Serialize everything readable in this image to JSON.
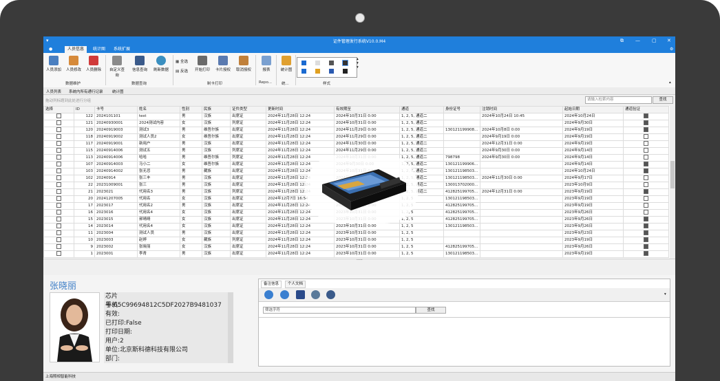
{
  "app": {
    "title": "证件管理发行系统V10.0.M4"
  },
  "menu": {
    "tabs": [
      "人员信息",
      "统计图",
      "系统扩展"
    ]
  },
  "ribbon": {
    "data_edit": {
      "label": "数据维护",
      "buttons": [
        "人员添加",
        "人员修改",
        "人员删除"
      ]
    },
    "data_query": {
      "label": "数据查询",
      "buttons": [
        "自定义查询",
        "信息查询",
        "刷新数据"
      ]
    },
    "card_print": {
      "label": "制卡打印",
      "select_all": "全选",
      "invert": "反选",
      "buttons": [
        "开始打印",
        "卡片授权",
        "取消授权"
      ]
    },
    "report": {
      "label": "Repo...",
      "button": "报表"
    },
    "stats": {
      "label": "统...",
      "button": "统计图"
    },
    "style": {
      "label": "样式"
    }
  },
  "subtabs": [
    "人员列表",
    "系统内所有通行记录",
    "统计图"
  ],
  "group_hint": "拖动列标题到此处进行分组",
  "search": {
    "placeholder": "请输入检索内容",
    "button": "查找"
  },
  "table": {
    "columns": [
      "选择",
      "ID",
      "卡号",
      "姓名",
      "性别",
      "民族",
      "证件类型",
      "更新时间",
      "有效期至",
      "通道",
      "身份证号",
      "注销时间",
      "起始日期",
      "通道验证"
    ],
    "rows": [
      {
        "id": "122",
        "card": "2024101101",
        "name": "test",
        "sex": "男",
        "nation": "汉族",
        "type": "出席证",
        "update": "2024年11月28日 12:24",
        "valid": "2024年10月31日 0:00",
        "channel": "1, 2, 5, 通道二",
        "idno": "",
        "cancel": "2024年10月24日 10:45",
        "start": "2024年10月24日",
        "verify": true
      },
      {
        "id": "121",
        "card": "20240930001",
        "name": "2024测试内容",
        "sex": "女",
        "nation": "汉族",
        "type": "列席证",
        "update": "2024年11月28日 12:24",
        "valid": "2024年10月31日 0:00",
        "channel": "1, 2, 5, 通道二",
        "idno": "",
        "cancel": "",
        "start": "2024年9月30日",
        "verify": true
      },
      {
        "id": "120",
        "card": "20240919003",
        "name": "测试3",
        "sex": "男",
        "nation": "维吾尔族",
        "type": "出席证",
        "update": "2024年11月28日 12:24",
        "valid": "2024年11月29日 0:00",
        "channel": "1, 2, 5, 通道二",
        "idno": "130121199908...",
        "cancel": "2024年10月8日 0:00",
        "start": "2024年9月19日",
        "verify": true
      },
      {
        "id": "118",
        "card": "20240919002",
        "name": "测试人员2",
        "sex": "女",
        "nation": "维吾尔族",
        "type": "出席证",
        "update": "2024年11月28日 12:24",
        "valid": "2024年11月29日 0:00",
        "channel": "1, 2, 5, 通道二",
        "idno": "",
        "cancel": "2024年9月19日 0:00",
        "start": "2024年9月19日",
        "verify": false
      },
      {
        "id": "117",
        "card": "20240919001",
        "name": "新用户",
        "sex": "男",
        "nation": "汉族",
        "type": "出席证",
        "update": "2024年11月28日 12:24",
        "valid": "2024年11月30日 0:00",
        "channel": "1, 2, 5, 通道二",
        "idno": "",
        "cancel": "2024年12月31日 0:00",
        "start": "2024年9月19日",
        "verify": false
      },
      {
        "id": "115",
        "card": "20240914006",
        "name": "测试五",
        "sex": "男",
        "nation": "汉族",
        "type": "列席证",
        "update": "2024年11月28日 12:24",
        "valid": "2024年11月29日 0:00",
        "channel": "1, 2, 5, 通道二",
        "idno": "",
        "cancel": "2024年9月30日 0:00",
        "start": "2024年9月14日",
        "verify": false
      },
      {
        "id": "113",
        "card": "20240914006",
        "name": "哈哈",
        "sex": "男",
        "nation": "维吾尔族",
        "type": "列席证",
        "update": "2024年11月28日 12:24",
        "valid": "2024年10月31日 0:00",
        "channel": "1, 2, 5, 通道二",
        "idno": "798798",
        "cancel": "2024年9月30日 0:00",
        "start": "2024年9月14日",
        "verify": false
      },
      {
        "id": "107",
        "card": "20240914003",
        "name": "马小二",
        "sex": "女",
        "nation": "维吾尔族",
        "type": "出席证",
        "update": "2024年11月28日 12:24",
        "valid": "2024年9月30日 0:00",
        "channel": "1, 2, 5, 通道二",
        "idno": "130121199906...",
        "cancel": "",
        "start": "2024年9月14日",
        "verify": true
      },
      {
        "id": "103",
        "card": "20240914002",
        "name": "张无忌",
        "sex": "男",
        "nation": "藏族",
        "type": "出席证",
        "update": "2024年11月28日 12:24",
        "valid": "2024年10月31日 0:00",
        "channel": "1, 2, 5, 通道二",
        "idno": "130121198503...",
        "cancel": "",
        "start": "2024年10月24日",
        "verify": true
      },
      {
        "id": "102",
        "card": "20240914",
        "name": "张三丰",
        "sex": "男",
        "nation": "汉族",
        "type": "出席证",
        "update": "2024年11月28日 12:24",
        "valid": "2024年10月31日 0:00",
        "channel": "1, 2, 5, 通道二",
        "idno": "130121198503...",
        "cancel": "2024年11月30日 0:00",
        "start": "2024年9月17日",
        "verify": false
      },
      {
        "id": "22",
        "card": "20231009001",
        "name": "张三",
        "sex": "男",
        "nation": "汉族",
        "type": "出席证",
        "update": "2024年11月28日 12:24",
        "valid": "2023年10月31日 0:00",
        "channel": "1, 2, 5, 通道二",
        "idno": "130013702000...",
        "cancel": "",
        "start": "2023年10月9日",
        "verify": false
      },
      {
        "id": "21",
        "card": "2023021",
        "name": "代用名3",
        "sex": "男",
        "nation": "汉族",
        "type": "列席证",
        "update": "2024年11月28日 12:24",
        "valid": "2023年10月31日 0:00",
        "channel": "1, 2, 5, 通道二",
        "idno": "412825199705...",
        "cancel": "2024年12月31日 0:00",
        "start": "2023年9月19日",
        "verify": true
      },
      {
        "id": "20",
        "card": "20241207005",
        "name": "代用名",
        "sex": "女",
        "nation": "汉族",
        "type": "出席证",
        "update": "2024年12月7日 16:54",
        "valid": "2023年10月31日 0:00",
        "channel": "1, 2, 5",
        "idno": "130121198503...",
        "cancel": "",
        "start": "2023年9月19日",
        "verify": false
      },
      {
        "id": "17",
        "card": "2023017",
        "name": "代用名2",
        "sex": "男",
        "nation": "汉族",
        "type": "出席证",
        "update": "2024年11月28日 12:24",
        "valid": "2023年10月31日 0:00",
        "channel": "1, 2, 5",
        "idno": "412825199705...",
        "cancel": "",
        "start": "2023年9月19日",
        "verify": false
      },
      {
        "id": "16",
        "card": "2023016",
        "name": "代用名4",
        "sex": "女",
        "nation": "汉族",
        "type": "出席证",
        "update": "2024年11月28日 12:24",
        "valid": "2023年10月31日 0:00",
        "channel": "1, 2, 5",
        "idno": "412825199705...",
        "cancel": "",
        "start": "2023年9月26日",
        "verify": false
      },
      {
        "id": "15",
        "card": "2023015",
        "name": "郝晴晴",
        "sex": "女",
        "nation": "汉族",
        "type": "出席证",
        "update": "2024年11月28日 12:24",
        "valid": "2023年10月31日 0:00",
        "channel": "1, 2, 5",
        "idno": "412825199705...",
        "cancel": "",
        "start": "2023年9月26日",
        "verify": true
      },
      {
        "id": "14",
        "card": "2023014",
        "name": "代用名4",
        "sex": "女",
        "nation": "汉族",
        "type": "出席证",
        "update": "2024年11月28日 12:24",
        "valid": "2023年10月31日 0:00",
        "channel": "1, 2, 5",
        "idno": "130121198503...",
        "cancel": "",
        "start": "2023年9月26日",
        "verify": true
      },
      {
        "id": "11",
        "card": "2023004",
        "name": "测试人员",
        "sex": "男",
        "nation": "汉族",
        "type": "出席证",
        "update": "2024年11月28日 12:24",
        "valid": "2023年10月31日 0:00",
        "channel": "1, 2, 5",
        "idno": "",
        "cancel": "",
        "start": "2023年9月23日",
        "verify": true
      },
      {
        "id": "10",
        "card": "2023003",
        "name": "赵婷",
        "sex": "女",
        "nation": "藏族",
        "type": "列席证",
        "update": "2024年11月28日 12:24",
        "valid": "2023年10月31日 0:00",
        "channel": "1, 2, 5",
        "idno": "",
        "cancel": "",
        "start": "2023年9月19日",
        "verify": true
      },
      {
        "id": "9",
        "card": "2023002",
        "name": "张晓丽",
        "sex": "女",
        "nation": "汉族",
        "type": "出席证",
        "update": "2024年11月28日 12:24",
        "valid": "2023年10月31日 0:00",
        "channel": "1, 2, 5",
        "idno": "412825199705...",
        "cancel": "",
        "start": "2023年9月26日",
        "verify": true
      },
      {
        "id": "1",
        "card": "2023001",
        "name": "李青",
        "sex": "男",
        "nation": "汉族",
        "type": "出席证",
        "update": "2024年11月28日 12:24",
        "valid": "2023年10月31日 0:00",
        "channel": "1, 2, 5",
        "idno": "130121198503...",
        "cancel": "",
        "start": "2023年9月19日",
        "verify": true
      }
    ]
  },
  "person": {
    "name": "张晓丽",
    "chip": "芯片号:65C99694812C5DF2027B9481037",
    "phone": "手机:",
    "valid": "有效:",
    "printed": "已打印:False",
    "print_date": "打印日期:",
    "user": "用户:2",
    "org": "单位:北京斯科德科技有限公司",
    "dept": "部门:"
  },
  "notes": {
    "tabs": [
      "备注信息",
      "个人文档"
    ],
    "filter_placeholder": "筛选字符",
    "find": "查找"
  },
  "status": {
    "text": "上海照相智能科技"
  },
  "colors": {
    "accent": "#1f7fdc",
    "name_blue": "#3f7fc7"
  }
}
